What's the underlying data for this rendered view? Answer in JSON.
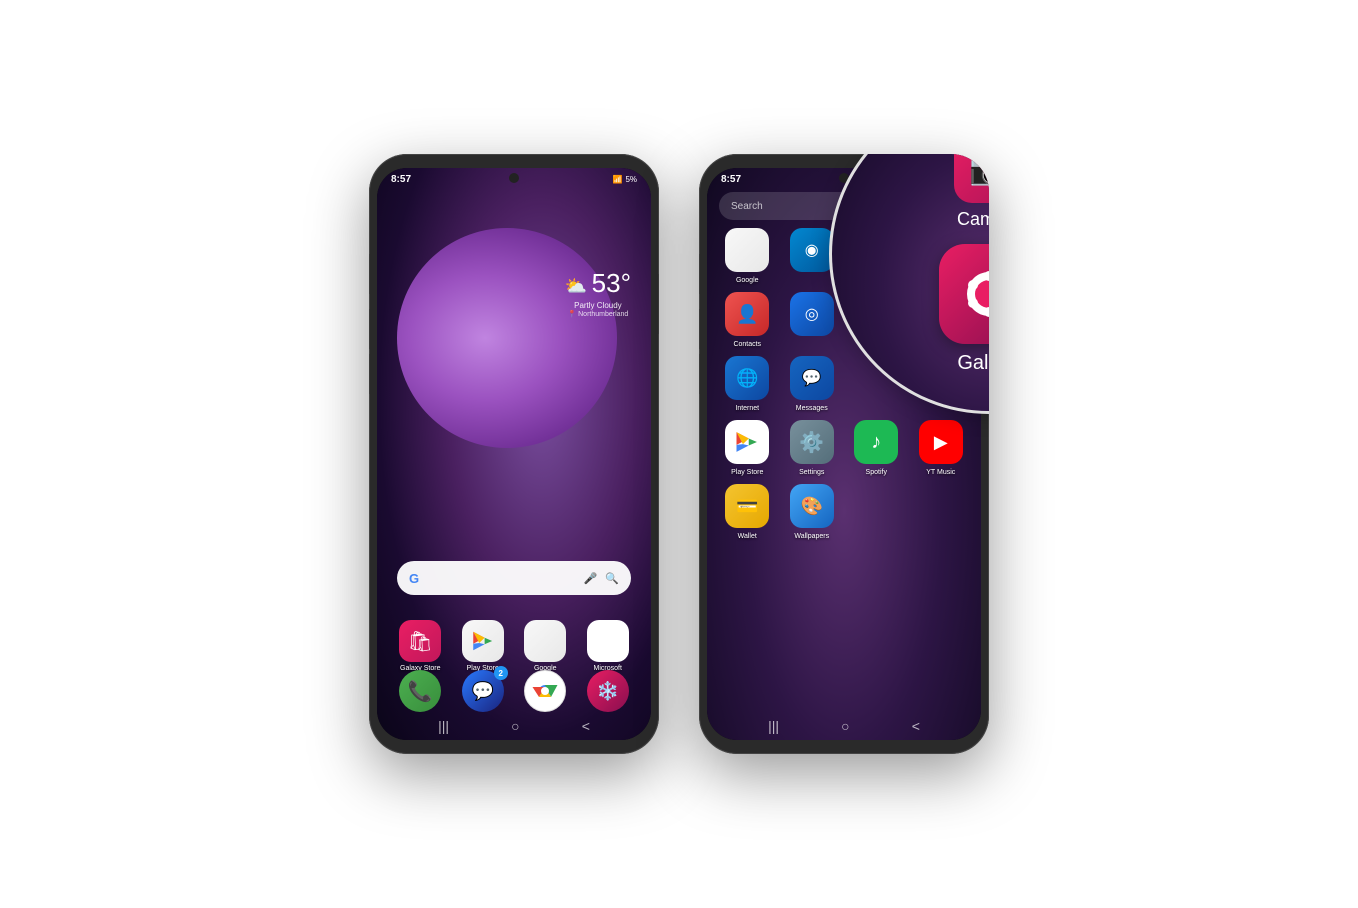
{
  "page": {
    "bg": "#ffffff"
  },
  "phone1": {
    "status": {
      "time": "8:57",
      "signal": "▲▼",
      "battery": "5%"
    },
    "weather": {
      "icon": "⛅",
      "temp": "53°",
      "desc": "Partly Cloudy",
      "location": "📍 Northumberland"
    },
    "search": {
      "g_logo": "G",
      "placeholder": ""
    },
    "apps": [
      {
        "label": "Galaxy Store",
        "icon": "🛍️",
        "style": "galaxy-store"
      },
      {
        "label": "Play Store",
        "icon": "▶",
        "style": "play-store"
      },
      {
        "label": "Google",
        "icon": "G",
        "style": "google"
      },
      {
        "label": "Microsoft",
        "icon": "⊞",
        "style": "microsoft"
      }
    ],
    "quick_apps": [
      {
        "label": "",
        "icon": "📞",
        "style": "phone"
      },
      {
        "label": "",
        "icon": "💬",
        "style": "messages",
        "badge": "2"
      },
      {
        "label": "",
        "icon": "⊙",
        "style": "chrome"
      },
      {
        "label": "",
        "icon": "📷",
        "style": "camera"
      }
    ],
    "nav": [
      "|||",
      "○",
      "<"
    ]
  },
  "phone2": {
    "status": {
      "time": "8:57",
      "signal": "▲▼",
      "battery": ""
    },
    "search_placeholder": "Search",
    "apps": [
      {
        "row": 0,
        "col": 0,
        "label": "Google",
        "icon": "G",
        "style": "google"
      },
      {
        "row": 0,
        "col": 1,
        "label": "",
        "icon": "◉",
        "style": "messages"
      },
      {
        "row": 0,
        "col": 2,
        "label": "",
        "icon": "",
        "style": ""
      },
      {
        "row": 0,
        "col": 3,
        "label": "",
        "icon": "",
        "style": ""
      },
      {
        "row": 1,
        "col": 0,
        "label": "Contacts",
        "icon": "👤",
        "style": "contacts"
      },
      {
        "row": 1,
        "col": 1,
        "label": "",
        "icon": "",
        "style": ""
      },
      {
        "row": 2,
        "col": 0,
        "label": "Internet",
        "icon": "◎",
        "style": "internet"
      },
      {
        "row": 2,
        "col": 1,
        "label": "Messages",
        "icon": "💬",
        "style": "messages"
      },
      {
        "row": 3,
        "col": 0,
        "label": "Play Store",
        "icon": "▶",
        "style": "play-store"
      },
      {
        "row": 3,
        "col": 1,
        "label": "Settings",
        "icon": "⚙",
        "style": "settings"
      },
      {
        "row": 3,
        "col": 2,
        "label": "Spotify",
        "icon": "♪",
        "style": "spotify"
      },
      {
        "row": 3,
        "col": 3,
        "label": "YT Music",
        "icon": "▶",
        "style": "ytmusic"
      },
      {
        "row": 4,
        "col": 0,
        "label": "Wallet",
        "icon": "💳",
        "style": "wallet"
      },
      {
        "row": 4,
        "col": 1,
        "label": "Wallpapers",
        "icon": "🎨",
        "style": "wallpapers"
      }
    ],
    "magnifier": {
      "camera_label": "Camera",
      "gallery_label": "Gallery"
    },
    "nav": [
      "|||",
      "○",
      "<"
    ]
  }
}
